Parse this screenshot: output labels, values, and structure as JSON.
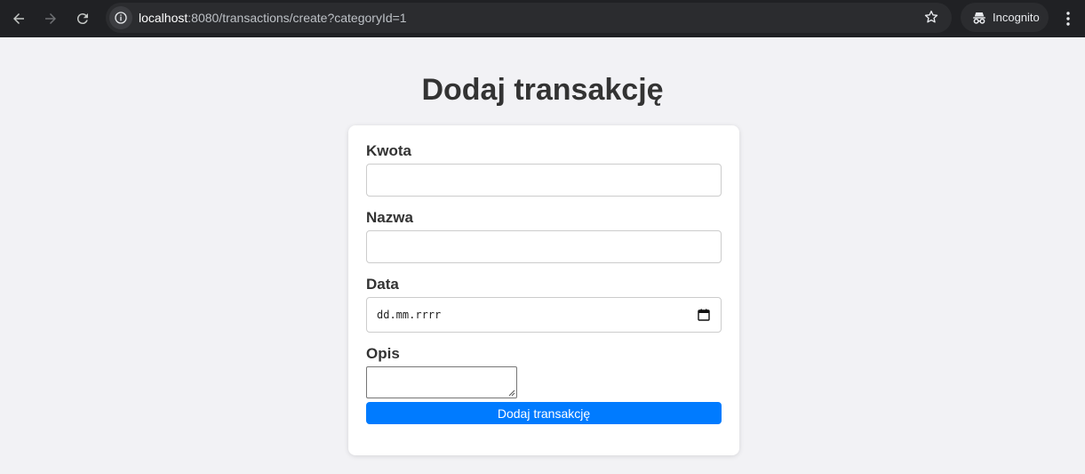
{
  "browser": {
    "url_host": "localhost",
    "url_rest": ":8080/transactions/create?categoryId=1",
    "incognito_label": "Incognito",
    "icons": [
      "back-arrow-icon",
      "forward-arrow-icon",
      "reload-icon",
      "info-icon",
      "star-icon",
      "incognito-icon",
      "kebab-menu-icon"
    ]
  },
  "page": {
    "title": "Dodaj transakcję"
  },
  "form": {
    "amount_label": "Kwota",
    "amount_value": "",
    "name_label": "Nazwa",
    "name_value": "",
    "date_label": "Data",
    "date_placeholder": "dd.mm.rrrr",
    "description_label": "Opis",
    "description_value": "",
    "submit_label": "Dodaj transakcję"
  },
  "colors": {
    "browser_bar": "#202124",
    "page_background": "#f2f2f5",
    "card_background": "#ffffff",
    "submit_button": "#007bff",
    "text": "#333333"
  }
}
